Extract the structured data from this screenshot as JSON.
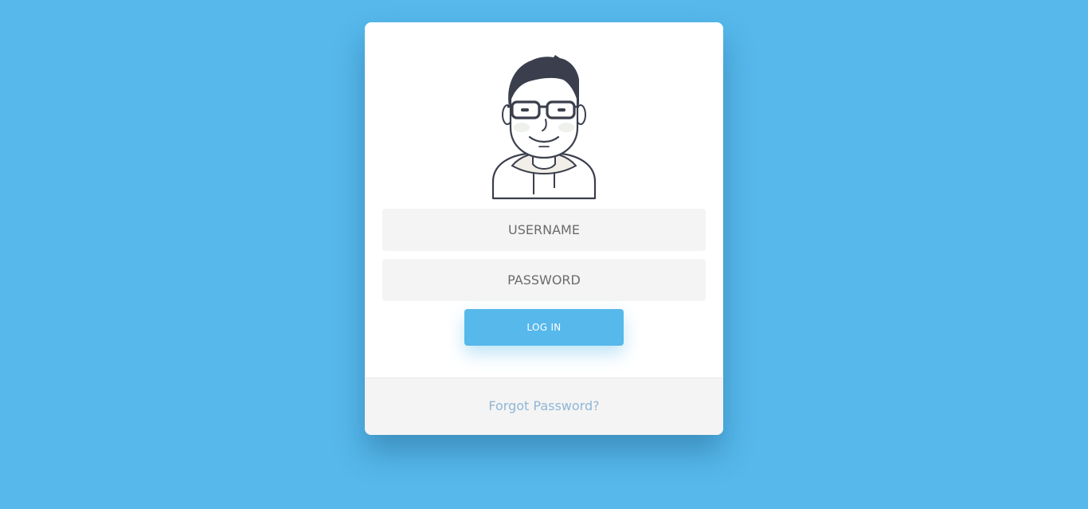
{
  "login": {
    "username_placeholder": "USERNAME",
    "password_placeholder": "PASSWORD",
    "login_label": "LOG IN",
    "forgot_label": "Forgot Password?"
  },
  "icons": {
    "avatar": "user-avatar-illustration"
  },
  "colors": {
    "background": "#56b8eb",
    "accent": "#56b8eb",
    "card": "#ffffff",
    "field": "#f4f4f4",
    "link": "#8fb6d6"
  }
}
